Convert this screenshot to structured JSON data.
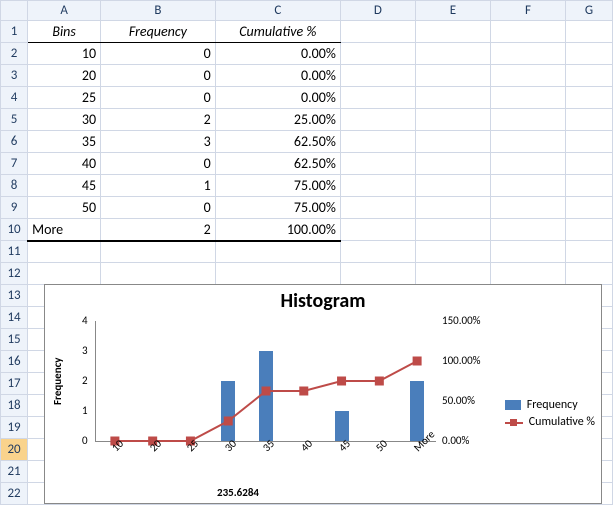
{
  "columns": [
    "A",
    "B",
    "C",
    "D",
    "E",
    "F",
    "G"
  ],
  "rowCount": 22,
  "selectedRow": 20,
  "table": {
    "headers": {
      "bins": "Bins",
      "freq": "Frequency",
      "cum": "Cumulative %"
    },
    "rows": [
      {
        "bin": "10",
        "freq": "0",
        "cum": "0.00%"
      },
      {
        "bin": "20",
        "freq": "0",
        "cum": "0.00%"
      },
      {
        "bin": "25",
        "freq": "0",
        "cum": "0.00%"
      },
      {
        "bin": "30",
        "freq": "2",
        "cum": "25.00%"
      },
      {
        "bin": "35",
        "freq": "3",
        "cum": "62.50%"
      },
      {
        "bin": "40",
        "freq": "0",
        "cum": "62.50%"
      },
      {
        "bin": "45",
        "freq": "1",
        "cum": "75.00%"
      },
      {
        "bin": "50",
        "freq": "0",
        "cum": "75.00%"
      },
      {
        "bin": "More",
        "freq": "2",
        "cum": "100.00%"
      }
    ]
  },
  "chart_data": {
    "type": "bar",
    "title": "Histogram",
    "ylabel": "Frequency",
    "categories": [
      "10",
      "20",
      "25",
      "30",
      "35",
      "40",
      "45",
      "50",
      "More"
    ],
    "series": [
      {
        "name": "Frequency",
        "type": "bar",
        "values": [
          0,
          0,
          0,
          2,
          3,
          0,
          1,
          0,
          2
        ],
        "color": "#4a7ebb",
        "axis": "primary"
      },
      {
        "name": "Cumulative %",
        "type": "line",
        "values": [
          0,
          0,
          0,
          25,
          62.5,
          62.5,
          75,
          75,
          100
        ],
        "color": "#be4b48",
        "axis": "secondary"
      }
    ],
    "ylim": [
      0,
      4
    ],
    "yticks": [
      0,
      1,
      2,
      3,
      4
    ],
    "y2lim": [
      0,
      150
    ],
    "y2ticks": [
      "0.00%",
      "50.00%",
      "100.00%",
      "150.00%"
    ],
    "xnote": "235.6284"
  },
  "legend": {
    "freq": "Frequency",
    "cum": "Cumulative %"
  }
}
